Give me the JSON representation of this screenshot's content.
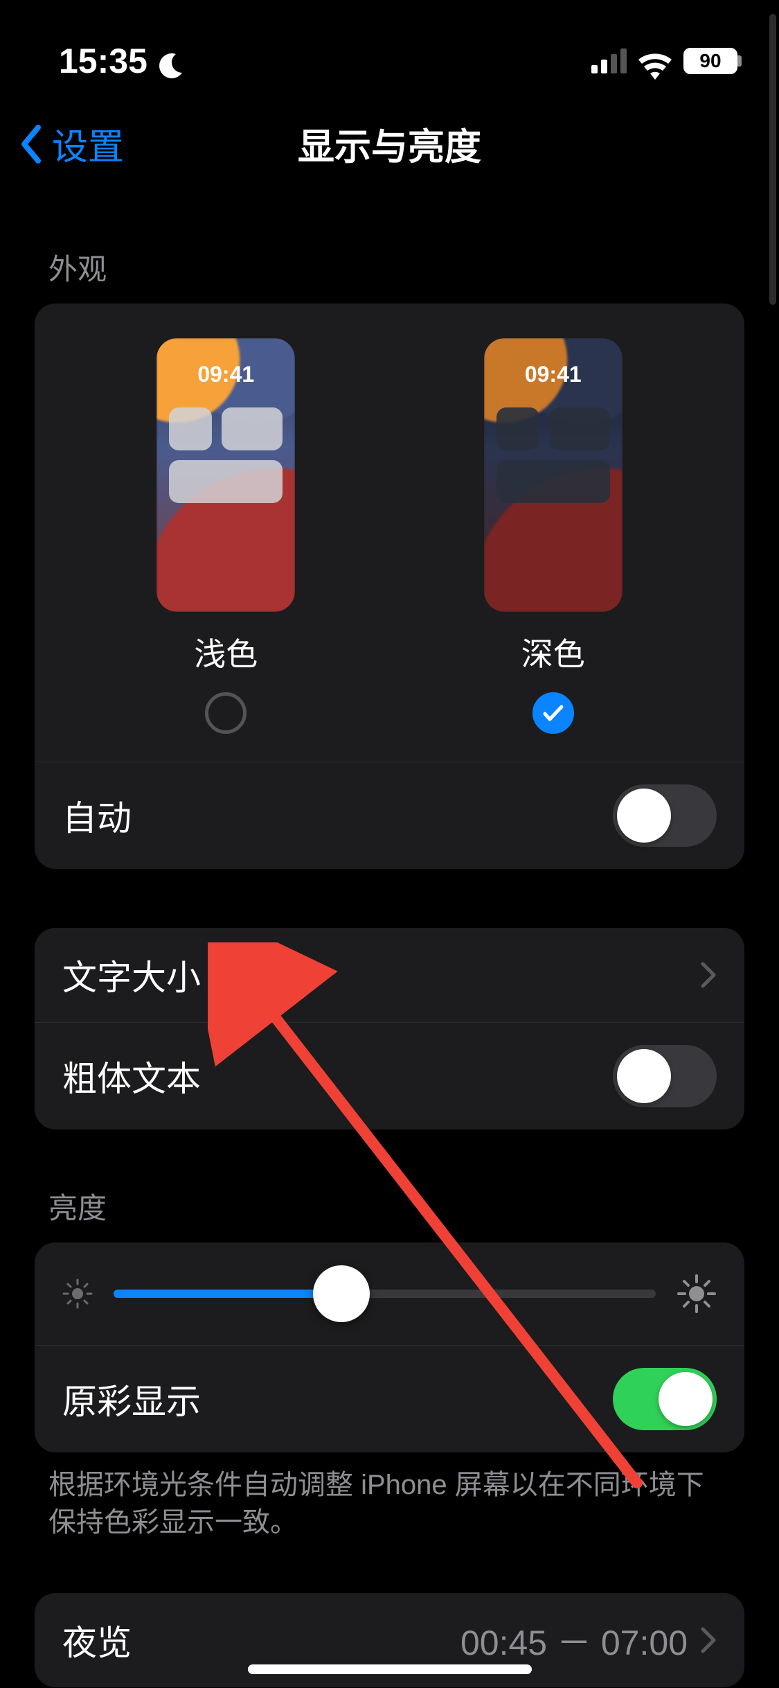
{
  "status": {
    "time": "15:35",
    "battery_pct": "90"
  },
  "nav": {
    "back_label": "设置",
    "title": "显示与亮度"
  },
  "appearance": {
    "header": "外观",
    "light_label": "浅色",
    "dark_label": "深色",
    "preview_time": "09:41",
    "selected": "dark",
    "auto_label": "自动",
    "auto_on": false
  },
  "text_section": {
    "text_size_label": "文字大小",
    "bold_text_label": "粗体文本",
    "bold_on": false
  },
  "brightness": {
    "header": "亮度",
    "value_pct": 42,
    "true_tone_label": "原彩显示",
    "true_tone_on": true,
    "footer": "根据环境光条件自动调整 iPhone 屏幕以在不同环境下保持色彩显示一致。"
  },
  "night_shift": {
    "label": "夜览",
    "schedule": "00:45 － 07:00"
  }
}
